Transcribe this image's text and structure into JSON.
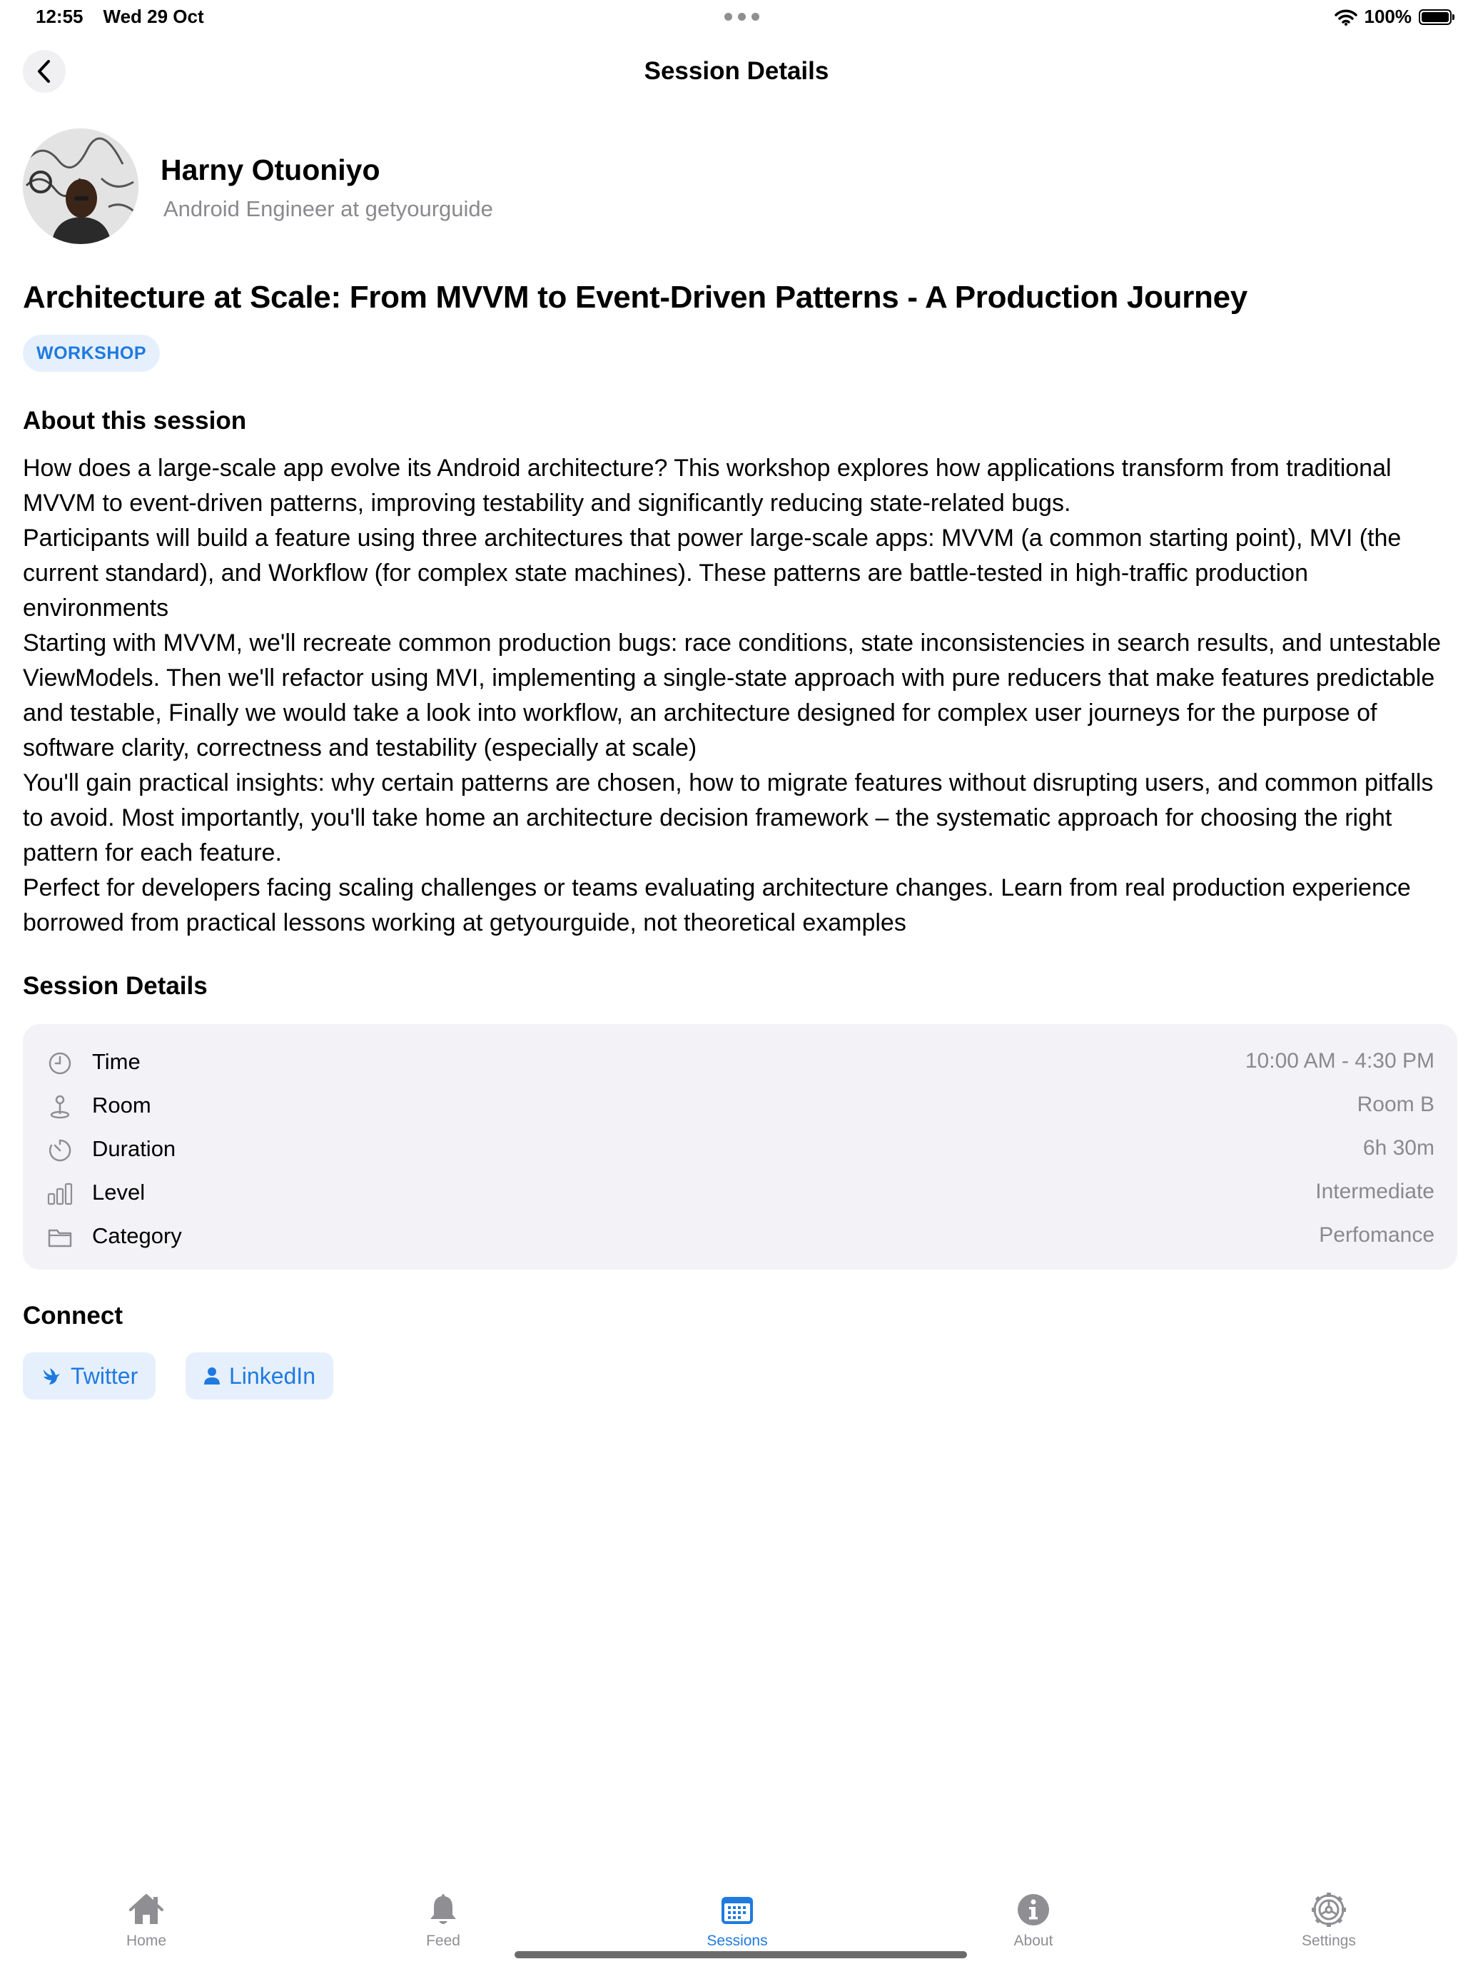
{
  "status_bar": {
    "time": "12:55",
    "date": "Wed 29 Oct",
    "battery_text": "100%",
    "battery_level": 1.0
  },
  "nav": {
    "title": "Session Details",
    "back_icon": "chevron-left-icon"
  },
  "speaker": {
    "name": "Harny Otuoniyo",
    "role": "Android Engineer at getyourguide"
  },
  "session": {
    "title": "Architecture at Scale: From MVVM to Event-Driven Patterns - A Production Journey",
    "type_badge": "WORKSHOP"
  },
  "about": {
    "heading": "About this session",
    "paragraphs": [
      "How does a large-scale app evolve its Android architecture? This workshop explores how applications transform from traditional MVVM to event-driven patterns, improving testability and significantly reducing state-related bugs.",
      "Participants will build a feature using three architectures that power large-scale apps: MVVM (a common starting point), MVI (the current standard), and Workflow (for complex state machines). These patterns are battle-tested in high-traffic production environments",
      "Starting with MVVM, we'll recreate common production bugs: race conditions, state inconsistencies in search results, and untestable ViewModels. Then we'll refactor using MVI, implementing a single-state approach with pure reducers that make features predictable and testable, Finally we would take a look into workflow, an architecture designed for complex user journeys for the purpose of software clarity, correctness and testability (especially at scale)",
      "You'll gain practical insights: why certain patterns are chosen, how to migrate features without disrupting users, and common pitfalls to avoid. Most importantly, you'll take home an architecture decision framework – the systematic approach for choosing the right pattern for each feature.",
      "Perfect for developers facing scaling challenges or teams evaluating architecture changes. Learn from real production experience borrowed from practical lessons working at getyourguide, not theoretical examples"
    ]
  },
  "details": {
    "heading": "Session Details",
    "rows": [
      {
        "icon": "clock-icon",
        "label": "Time",
        "value": "10:00 AM - 4:30 PM"
      },
      {
        "icon": "location-pin-icon",
        "label": "Room",
        "value": "Room B"
      },
      {
        "icon": "timer-icon",
        "label": "Duration",
        "value": "6h 30m"
      },
      {
        "icon": "bar-chart-icon",
        "label": "Level",
        "value": "Intermediate"
      },
      {
        "icon": "folder-icon",
        "label": "Category",
        "value": "Perfomance"
      }
    ]
  },
  "connect": {
    "heading": "Connect",
    "twitter_label": "Twitter",
    "linkedin_label": "LinkedIn"
  },
  "tab_bar": {
    "items": [
      {
        "icon": "house-icon",
        "label": "Home",
        "active": false
      },
      {
        "icon": "bell-icon",
        "label": "Feed",
        "active": false
      },
      {
        "icon": "calendar-icon",
        "label": "Sessions",
        "active": true
      },
      {
        "icon": "info-icon",
        "label": "About",
        "active": false
      },
      {
        "icon": "gear-icon",
        "label": "Settings",
        "active": false
      }
    ]
  },
  "colors": {
    "accent": "#1f7ae0",
    "badge_bg": "#e6f0fc",
    "card_bg": "#f2f2f7",
    "secondary_text": "#8a8a8e"
  }
}
